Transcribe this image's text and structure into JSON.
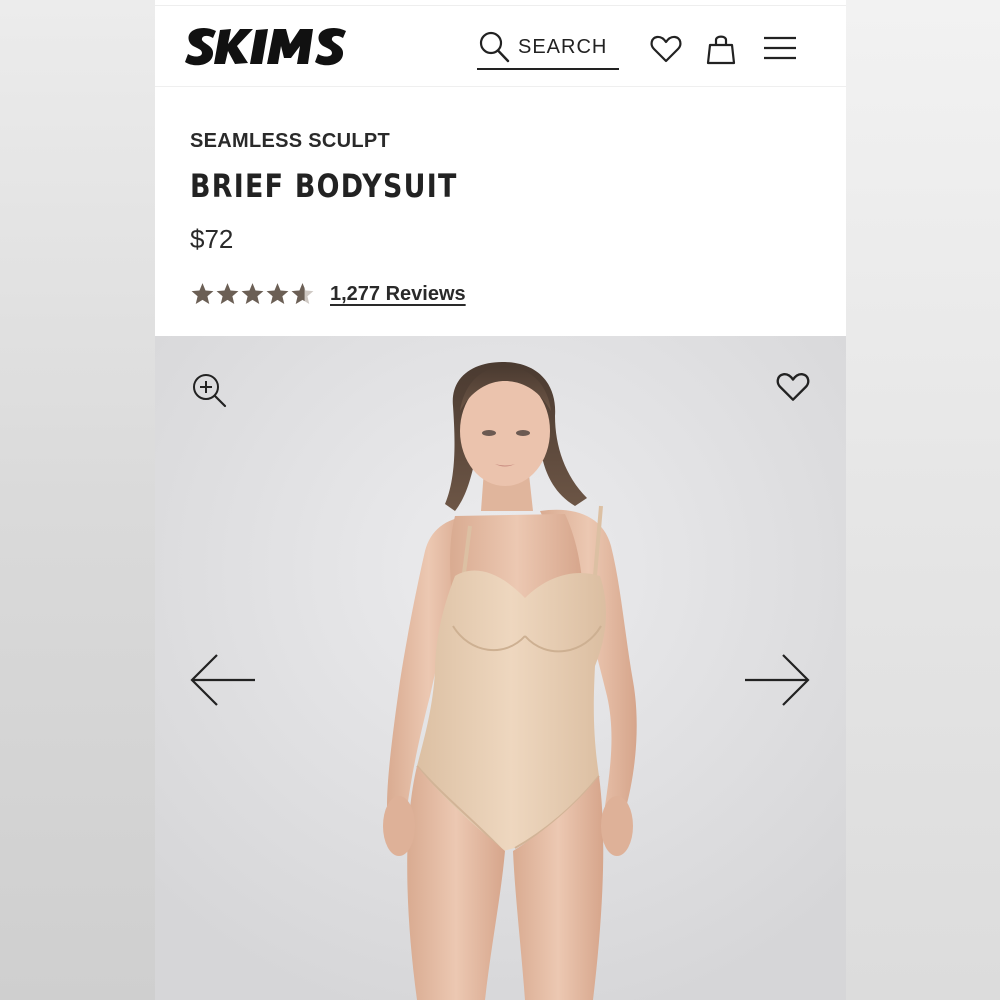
{
  "brand": {
    "logo_text": "SKIMS"
  },
  "header": {
    "search_label": "SEARCH",
    "icons": [
      "search-icon",
      "heart-icon",
      "shopping-bag-icon",
      "menu-icon"
    ]
  },
  "product": {
    "collection": "SEAMLESS SCULPT",
    "name": "BRIEF BODYSUIT",
    "price": "$72",
    "rating": 4.5,
    "rating_max": 5,
    "reviews_label": "1,277 Reviews"
  },
  "gallery": {
    "icons": [
      "zoom-in-icon",
      "heart-icon",
      "arrow-left-icon",
      "arrow-right-icon"
    ]
  },
  "colors": {
    "text": "#222222",
    "star": "#6b5f55",
    "bodysuit": "#e6cdb1",
    "gallery_bg": "#dedee0"
  }
}
